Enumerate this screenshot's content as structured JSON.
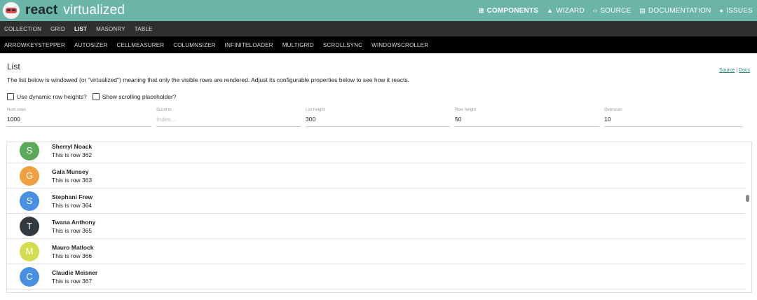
{
  "header": {
    "brand_part1": "react",
    "brand_part2": "virtualized",
    "links": [
      {
        "icon": "grid-icon",
        "glyph": "⊞",
        "label": "COMPONENTS"
      },
      {
        "icon": "wizard-icon",
        "glyph": "▲",
        "label": "WIZARD"
      },
      {
        "icon": "code-icon",
        "glyph": "‹›",
        "label": "SOURCE"
      },
      {
        "icon": "book-icon",
        "glyph": "▤",
        "label": "DOCUMENTATION"
      },
      {
        "icon": "issue-icon",
        "glyph": "●",
        "label": "ISSUES"
      }
    ]
  },
  "nav1": [
    "COLLECTION",
    "GRID",
    "LIST",
    "MASONRY",
    "TABLE"
  ],
  "nav2": [
    "ARROWKEYSTEPPER",
    "AUTOSIZER",
    "CELLMEASURER",
    "COLUMNSIZER",
    "INFINITELOADER",
    "MULTIGRID",
    "SCROLLSYNC",
    "WINDOWSCROLLER"
  ],
  "page": {
    "title": "List",
    "source_link": "Source",
    "separator": "|",
    "docs_link": "Docs",
    "description": "The list below is windowed (or \"virtualized\") meaning that only the visible rows are rendered. Adjust its configurable properties below to see how it reacts."
  },
  "checkboxes": {
    "dynamic": "Use dynamic row heights?",
    "placeholder": "Show scrolling placeholder?"
  },
  "fields": {
    "num_rows": {
      "label": "Num rows",
      "value": "1000"
    },
    "scroll_to": {
      "label": "Scroll to",
      "placeholder": "Index..."
    },
    "list_height": {
      "label": "List height",
      "value": "300"
    },
    "row_height": {
      "label": "Row height",
      "value": "50"
    },
    "overscan": {
      "label": "Overscan",
      "value": "10"
    }
  },
  "rows": [
    {
      "letter": "S",
      "name": "Sherryl Noack",
      "text": "This is row 362",
      "color": "#5aaa5a"
    },
    {
      "letter": "G",
      "name": "Gala Munsey",
      "text": "This is row 363",
      "color": "#f0a040"
    },
    {
      "letter": "S",
      "name": "Stephani Frew",
      "text": "This is row 364",
      "color": "#4a90e2"
    },
    {
      "letter": "T",
      "name": "Twana Anthony",
      "text": "This is row 365",
      "color": "#333a40"
    },
    {
      "letter": "M",
      "name": "Mauro Matlock",
      "text": "This is row 366",
      "color": "#d4dc50"
    },
    {
      "letter": "C",
      "name": "Claudie Meisner",
      "text": "This is row 367",
      "color": "#4a90e2"
    },
    {
      "letter": "",
      "name": "",
      "text": "",
      "color": "#8e44ad"
    }
  ]
}
